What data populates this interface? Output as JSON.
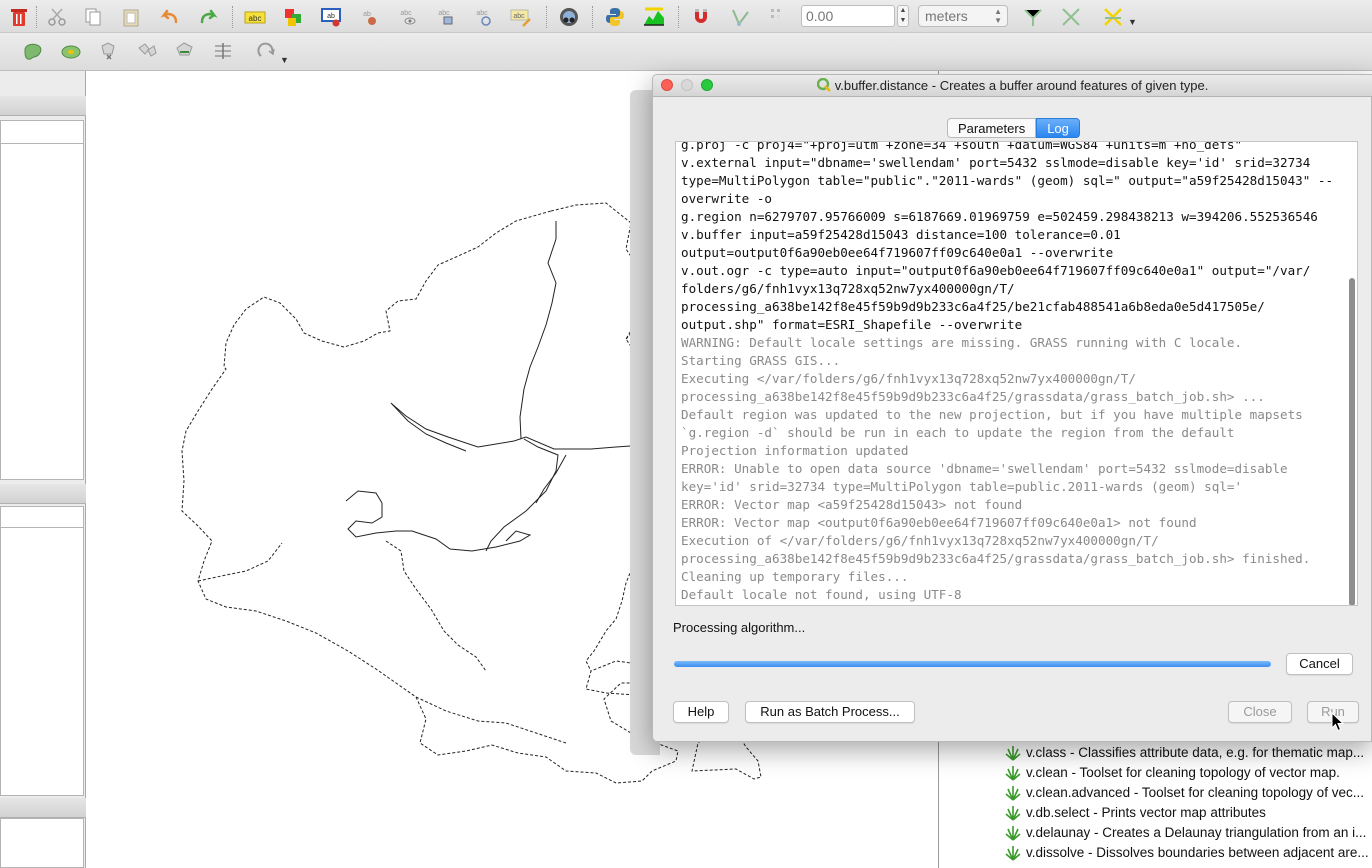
{
  "toolbar": {
    "snap_tolerance_value": "0.00",
    "units_value": "meters"
  },
  "toolbox": {
    "algorithms": [
      "v.class - Classifies attribute data, e.g. for thematic map...",
      "v.clean - Toolset for cleaning topology of vector map.",
      "v.clean.advanced - Toolset for cleaning topology of vec...",
      "v.db.select - Prints vector map attributes",
      "v.delaunay - Creates a Delaunay triangulation from an i...",
      "v.dissolve - Dissolves boundaries between adjacent are..."
    ]
  },
  "dialog": {
    "title": "v.buffer.distance - Creates a buffer around features of given type.",
    "tabs": {
      "parameters": "Parameters",
      "log": "Log"
    },
    "log_lines": [
      {
        "text": "g.proj -c proj4=\"+proj=utm +zone=34 +south +datum=WGS84 +units=m +no_defs\"",
        "gray": false
      },
      {
        "text": "v.external input=\"dbname='swellendam' port=5432 sslmode=disable key='id' srid=32734",
        "gray": false
      },
      {
        "text": "type=MultiPolygon table=\"public\".\"2011-wards\" (geom) sql=\" output=\"a59f25428d15043\" --",
        "gray": false
      },
      {
        "text": "overwrite -o",
        "gray": false
      },
      {
        "text": "g.region n=6279707.95766009 s=6187669.01969759 e=502459.298438213 w=394206.552536546",
        "gray": false
      },
      {
        "text": "v.buffer input=a59f25428d15043 distance=100 tolerance=0.01",
        "gray": false
      },
      {
        "text": "output=output0f6a90eb0ee64f719607ff09c640e0a1 --overwrite",
        "gray": false
      },
      {
        "text": "v.out.ogr -c type=auto input=\"output0f6a90eb0ee64f719607ff09c640e0a1\" output=\"/var/",
        "gray": false
      },
      {
        "text": "folders/g6/fnh1vyx13q728xq52nw7yx400000gn/T/",
        "gray": false
      },
      {
        "text": "processing_a638be142f8e45f59b9d9b233c6a4f25/be21cfab488541a6b8eda0e5d417505e/",
        "gray": false
      },
      {
        "text": "output.shp\" format=ESRI_Shapefile --overwrite",
        "gray": false
      },
      {
        "text": "WARNING: Default locale settings are missing. GRASS running with C locale.",
        "gray": true
      },
      {
        "text": "Starting GRASS GIS...",
        "gray": true
      },
      {
        "text": "Executing </var/folders/g6/fnh1vyx13q728xq52nw7yx400000gn/T/",
        "gray": true
      },
      {
        "text": "processing_a638be142f8e45f59b9d9b233c6a4f25/grassdata/grass_batch_job.sh> ...",
        "gray": true
      },
      {
        "text": "Default region was updated to the new projection, but if you have multiple mapsets",
        "gray": true
      },
      {
        "text": "`g.region -d` should be run in each to update the region from the default",
        "gray": true
      },
      {
        "text": "Projection information updated",
        "gray": true
      },
      {
        "text": "ERROR: Unable to open data source 'dbname='swellendam' port=5432 sslmode=disable",
        "gray": true
      },
      {
        "text": "key='id' srid=32734 type=MultiPolygon table=public.2011-wards (geom) sql='",
        "gray": true
      },
      {
        "text": "ERROR: Vector map <a59f25428d15043> not found",
        "gray": true
      },
      {
        "text": "ERROR: Vector map <output0f6a90eb0ee64f719607ff09c640e0a1> not found",
        "gray": true
      },
      {
        "text": "Execution of </var/folders/g6/fnh1vyx13q728xq52nw7yx400000gn/T/",
        "gray": true
      },
      {
        "text": "processing_a638be142f8e45f59b9d9b233c6a4f25/grassdata/grass_batch_job.sh> finished.",
        "gray": true
      },
      {
        "text": "Cleaning up temporary files...",
        "gray": true
      },
      {
        "text": "Default locale not found, using UTF-8",
        "gray": true
      }
    ],
    "status_text": "Processing algorithm...",
    "progress_fraction": 1.0,
    "buttons": {
      "cancel": "Cancel",
      "help": "Help",
      "batch": "Run as Batch Process...",
      "close": "Close",
      "run": "Run"
    }
  },
  "colors": {
    "accent": "#2b86f1",
    "close_light": "#fc5f57",
    "zoom_light": "#29c940"
  }
}
